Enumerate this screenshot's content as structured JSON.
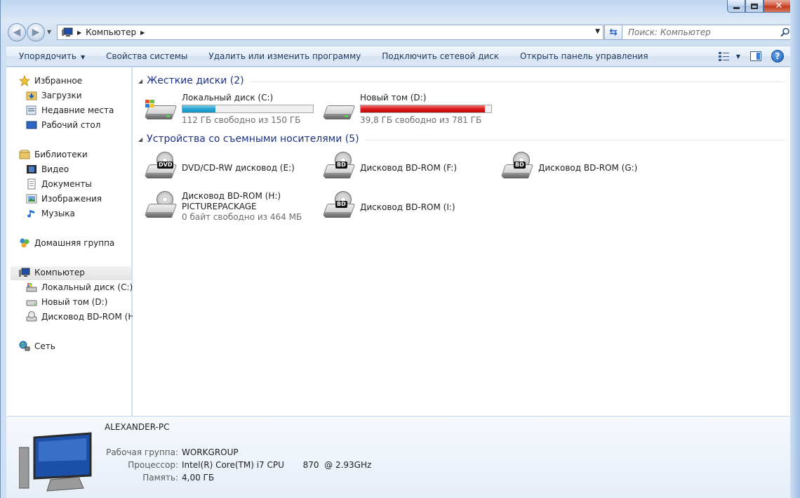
{
  "window": {
    "close_glyph": "✕"
  },
  "address_bar": {
    "location": "Компьютер",
    "search_placeholder": "Поиск: Компьютер"
  },
  "commands": {
    "organize": "Упорядочить",
    "system_properties": "Свойства системы",
    "uninstall": "Удалить или изменить программу",
    "map_drive": "Подключить сетевой диск",
    "control_panel": "Открыть панель управления"
  },
  "nav": {
    "favorites": "Избранное",
    "downloads": "Загрузки",
    "recent": "Недавние места",
    "desktop": "Рабочий стол",
    "libraries": "Библиотеки",
    "video": "Видео",
    "documents": "Документы",
    "images": "Изображения",
    "music": "Музыка",
    "homegroup": "Домашняя группа",
    "computer": "Компьютер",
    "drive_c": "Локальный диск (C:)",
    "drive_d": "Новый том (D:)",
    "drive_h": "Дисковод BD-ROM (H:)",
    "network": "Сеть"
  },
  "groups": {
    "hard_disks": "Жесткие диски (2)",
    "removable": "Устройства со съемными носителями (5)"
  },
  "drives": {
    "c": {
      "name": "Локальный диск (C:)",
      "free": "112 ГБ свободно из 150 ГБ",
      "used_fraction": 0.25
    },
    "d": {
      "name": "Новый том (D:)",
      "free": "39,8 ГБ свободно из 781 ГБ",
      "used_fraction": 0.95
    },
    "e": {
      "name": "DVD/CD-RW дисковод (E:)",
      "badge": "DVD"
    },
    "f": {
      "name": "Дисковод BD-ROM (F:)",
      "badge": "BD"
    },
    "g": {
      "name": "Дисковод BD-ROM (G:)",
      "badge": "BD"
    },
    "h": {
      "name": "Дисковод BD-ROM (H:)",
      "volume": "PICTUREPACKAGE",
      "free": "0 байт свободно из 464 МБ"
    },
    "i": {
      "name": "Дисковод BD-ROM (I:)",
      "badge": "BD"
    }
  },
  "details": {
    "computer_name": "ALEXANDER-PC",
    "workgroup_label": "Рабочая группа:",
    "workgroup": "WORKGROUP",
    "cpu_label": "Процессор:",
    "cpu": "Intel(R) Core(TM) i7 CPU       870  @ 2.93GHz",
    "memory_label": "Память:",
    "memory": "4,00 ГБ"
  }
}
